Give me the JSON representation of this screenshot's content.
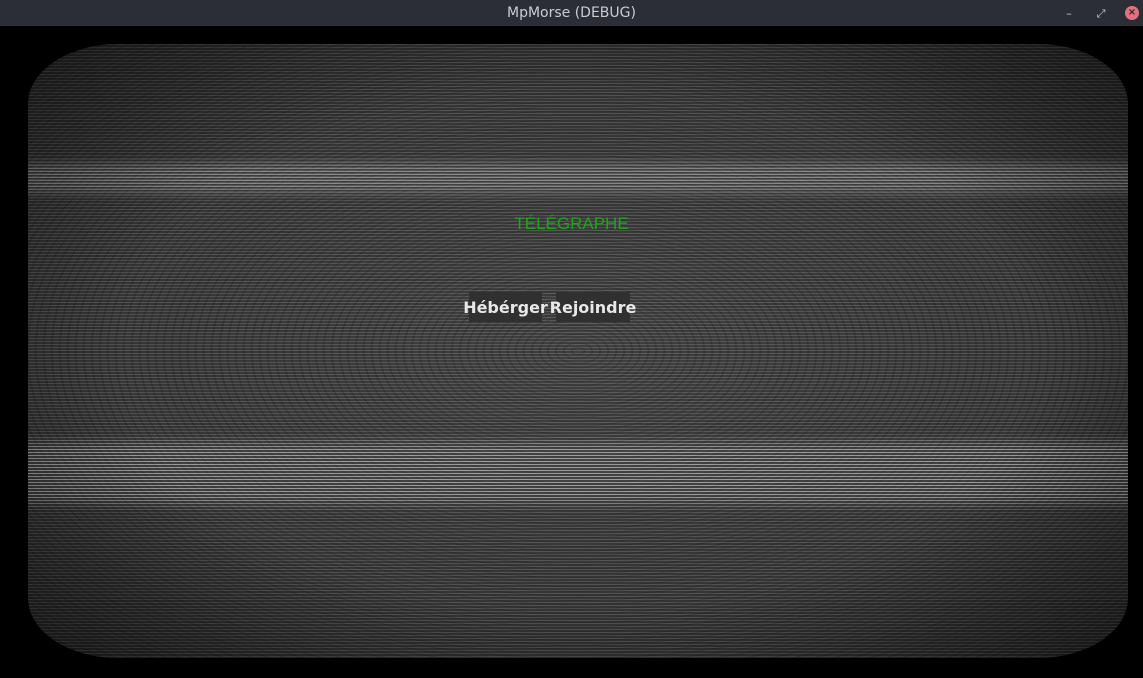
{
  "window": {
    "title": "MpMorse (DEBUG)",
    "controls": {
      "minimize_glyph": "–",
      "maximize_glyph": "⤢",
      "close_glyph": "×"
    }
  },
  "main_menu": {
    "title": "TÉLÉGRAPHE",
    "host_label": "Hébérger",
    "join_label": "Rejoindre"
  },
  "colors": {
    "titlebar_bg": "#2b2e37",
    "title_green": "#1fa51a",
    "button_bg": "#303030",
    "close_red": "#e0727e"
  },
  "icons": {
    "minimize": "minimize-icon",
    "maximize": "maximize-icon",
    "close": "close-icon"
  }
}
